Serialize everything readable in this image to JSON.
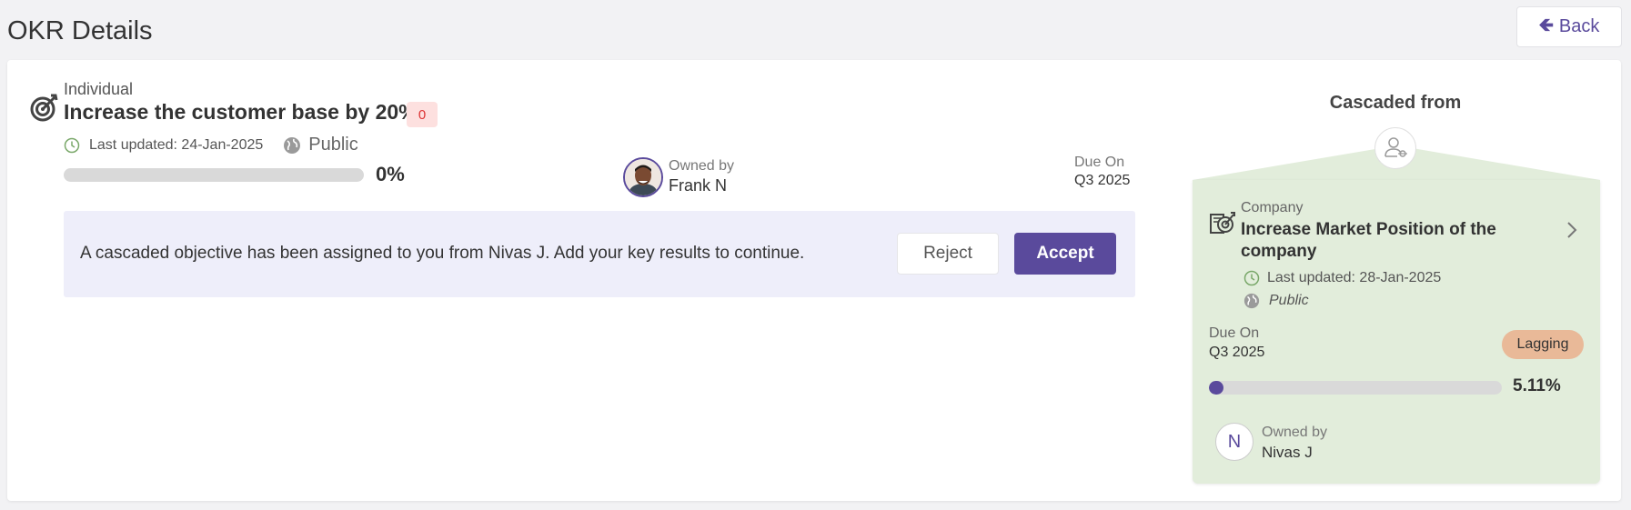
{
  "header": {
    "title": "OKR Details",
    "back_label": "Back"
  },
  "okr": {
    "type": "Individual",
    "title": "Increase the customer base by 20%.",
    "badge": "0",
    "last_updated": "Last updated: 24-Jan-2025",
    "visibility": "Public",
    "progress_pct": "0%",
    "progress_value": 0,
    "owner_label": "Owned by",
    "owner_name": "Frank N",
    "due_label": "Due On",
    "due_value": "Q3 2025"
  },
  "notice": {
    "text": "A cascaded objective has been assigned to you from Nivas J. Add your key results to continue.",
    "reject_label": "Reject",
    "accept_label": "Accept"
  },
  "cascaded": {
    "heading": "Cascaded from",
    "type": "Company",
    "title": "Increase Market Position of the company",
    "last_updated": "Last updated: 28-Jan-2025",
    "visibility": "Public",
    "due_label": "Due On",
    "due_value": "Q3 2025",
    "status": "Lagging",
    "progress_pct": "5.11%",
    "progress_value": 5.11,
    "owner_initial": "N",
    "owner_label": "Owned by",
    "owner_name": "Nivas J"
  },
  "colors": {
    "accent": "#5a4a9c",
    "badge_bg": "#fde0df",
    "badge_text": "#dd3333",
    "cascade_bg": "#e2eddb",
    "lagging_bg": "#e9b998",
    "notice_bg": "#eeeefa"
  }
}
